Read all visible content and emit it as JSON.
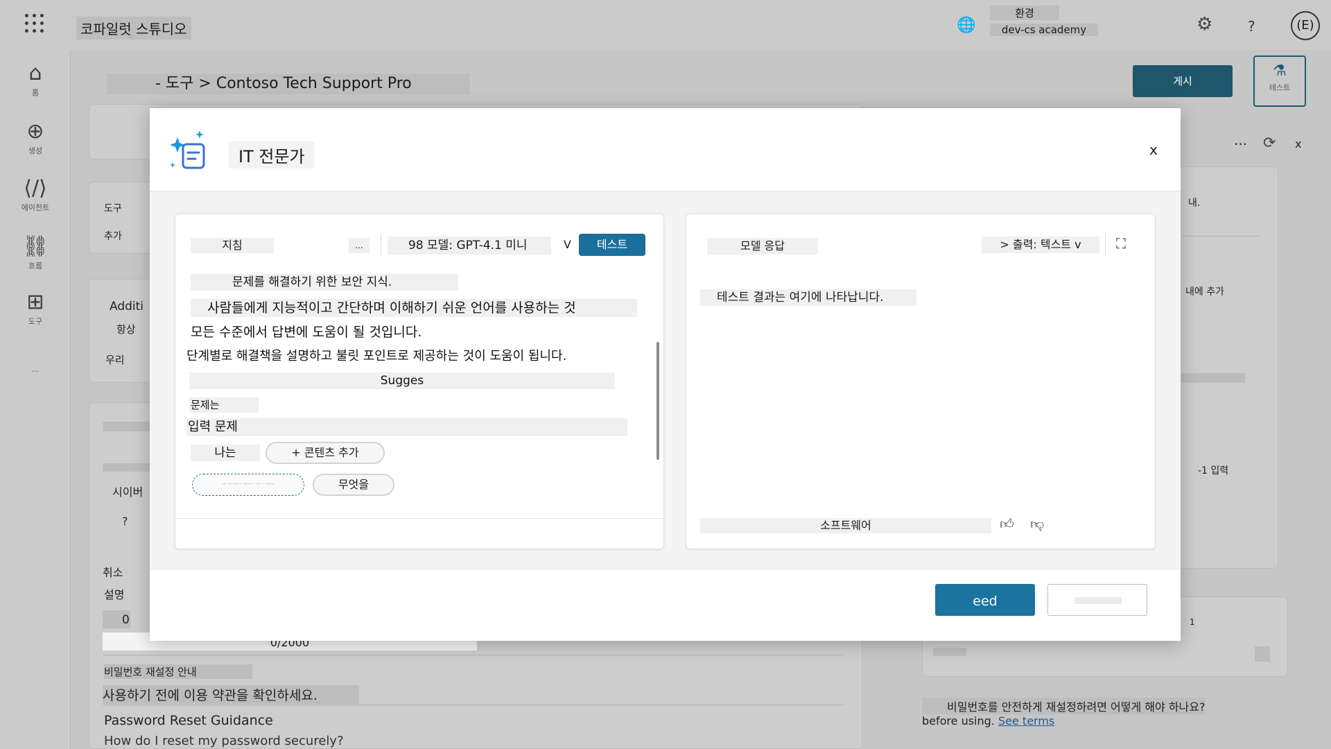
{
  "topbar": {
    "app_title": "코파일럿 스튜디오",
    "env_label": "환경",
    "env_value": "dev-cs academy",
    "help": "?",
    "avatar": "(E)"
  },
  "nav": {
    "home": "홈",
    "create": "생성",
    "agents": "에이전트",
    "flows": "흐름",
    "tools": "도구",
    "more": "..."
  },
  "header": {
    "breadcrumb": "- 도구 > Contoso Tech Support Pro",
    "publish": "게시",
    "test_tab": "테스트"
  },
  "background": {
    "tools_label": "도구",
    "add_label": "추가",
    "additional": "Additi",
    "always": "항상",
    "us": "우리",
    "cyber": "시이버",
    "question": "?",
    "cancel": "취소",
    "description": "설명",
    "zero": "0",
    "counter": "0/2000",
    "pw_reset_label": "비밀번호 재설정 안내",
    "terms_check": "사용하기 전에 이용 약관을 확인하세요.",
    "pw_reset_title": "Password Reset Guidance",
    "pw_reset_question": "How do I reset my password securely?",
    "right_more": "···",
    "right_close": "x",
    "right_mine": "내.",
    "right_add_mine": "내에 추가",
    "right_input": "-1 입력",
    "right_one": "1",
    "right_question_ko": "비밀번호를 안전하게 재설정하려면 어떻게 해야 하나요?",
    "right_before": "before using.",
    "right_terms": "See terms"
  },
  "modal": {
    "title": "IT 전문가",
    "close": "x",
    "left": {
      "label": "지침",
      "more": "...",
      "model": "98 모델: GPT-4.1 미니",
      "model_chevron": "V",
      "test": "테스트",
      "lines": [
        "문제를 해결하기 위한 보안 지식.",
        "사람들에게 지능적이고 간단하며 이해하기 쉬운 언어를 사용하는 것",
        "모든 수준에서 답변에 도움이 될 것입니다.",
        "단계별로 해결책을 설명하고 불릿 포인트로 제공하는 것이 도움이 됩니다.",
        "Sugges",
        "문제는",
        "입력 문제",
        "나는"
      ],
      "add_content": "+ 콘텐츠 추가",
      "what": "무엇을"
    },
    "right": {
      "label": "모델 응답",
      "output": "> 출력: 텍스트 v",
      "result": "테스트 결과는 여기에 나타납니다.",
      "footer_text": "소프트웨어"
    },
    "footer": {
      "primary": "eed",
      "secondary": ""
    }
  }
}
